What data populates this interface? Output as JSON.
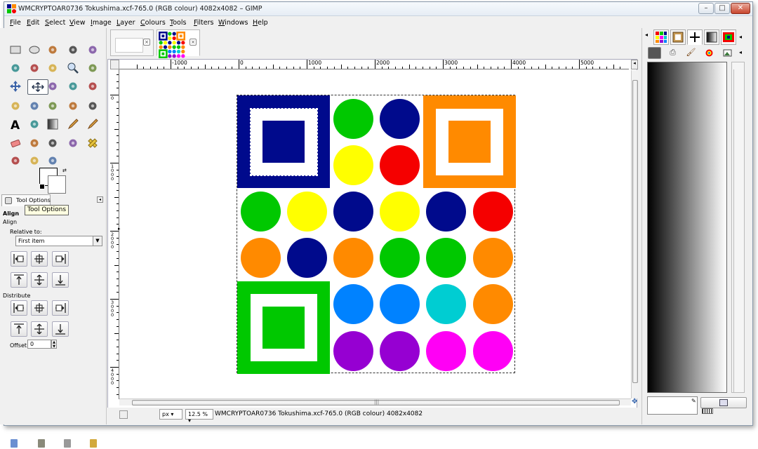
{
  "window": {
    "title": "WMCRYPTOAR0736 Tokushima.xcf-765.0 (RGB colour) 4082x4082 – GIMP",
    "controls": {
      "minimize": "–",
      "maximize": "□",
      "close": "✕"
    }
  },
  "menubar": [
    "File",
    "Edit",
    "Select",
    "View",
    "Image",
    "Layer",
    "Colours",
    "Tools",
    "Filters",
    "Windows",
    "Help"
  ],
  "toolbox": {
    "tools": [
      "rect-select-icon",
      "ellipse-select-icon",
      "free-select-icon",
      "fuzzy-select-icon",
      "scissors-icon",
      "color-select-icon",
      "paths-icon",
      "color-picker-icon",
      "zoom-icon",
      "measure-icon",
      "move-icon",
      "align-icon",
      "crop-icon",
      "rotate-icon",
      "scale-icon",
      "shear-icon",
      "perspective-icon",
      "flip-icon",
      "cage-icon",
      "warp-icon",
      "text-icon",
      "bucket-fill-icon",
      "blend-icon",
      "pencil-icon",
      "paintbrush-icon",
      "eraser-icon",
      "airbrush-icon",
      "ink-icon",
      "clone-icon",
      "heal-icon",
      "blur-icon",
      "smudge-icon",
      "dodge-icon"
    ],
    "fg_color": "#ffffff",
    "bg_color": "#ffffff"
  },
  "tool_options": {
    "tab_label": "Tool Options",
    "tooltip": "Tool Options",
    "title": "Align",
    "subtitle": "Align",
    "relative_to_label": "Relative to:",
    "relative_to_value": "First item",
    "distribute_label": "Distribute",
    "offset_label": "Offset:",
    "offset_value": "0"
  },
  "rulers": {
    "horizontal": [
      "-1000",
      "0",
      "1000",
      "2000",
      "3000",
      "4000",
      "5000"
    ],
    "vertical": [
      "0",
      "1000",
      "2000",
      "3000",
      "4000"
    ]
  },
  "statusbar": {
    "unit": "px",
    "zoom": "12.5 %",
    "text": "WMCRYPTOAR0736 Tokushima.xcf-765.0 (RGB colour) 4082x4082"
  },
  "hscroll_grip": "|||",
  "colors": {
    "navy": "#000a8c",
    "orange": "#ff8a00",
    "green": "#00c800",
    "yellow": "#ffff00",
    "red": "#f50000",
    "blue": "#0082ff",
    "cyan": "#00cdd2",
    "purple": "#9600d2",
    "magenta": "#ff00f5"
  },
  "image_grid": {
    "rows": [
      [
        "navy-square",
        "navy-square",
        "green",
        "navy",
        "orange-square",
        "orange-square"
      ],
      [
        "navy-square",
        "navy-square",
        "yellow",
        "red",
        "orange-square",
        "orange-square"
      ],
      [
        "green",
        "yellow",
        "navy",
        "yellow",
        "navy",
        "red"
      ],
      [
        "orange",
        "navy",
        "orange",
        "green",
        "green",
        "orange"
      ],
      [
        "green-square",
        "green-square",
        "blue",
        "blue",
        "cyan",
        "orange"
      ],
      [
        "green-square",
        "green-square",
        "purple",
        "purple",
        "magenta",
        "magenta"
      ]
    ]
  },
  "right_dock": {
    "tab_icons": [
      "palette-icon",
      "brush-preview-icon",
      "pattern-icon",
      "gradient-icon",
      "fonts-icon"
    ],
    "sub_icons": [
      "gradient-tab-icon",
      "printer-icon",
      "paintbrush-icon",
      "colour-wheel-icon",
      "picture-icon"
    ]
  }
}
